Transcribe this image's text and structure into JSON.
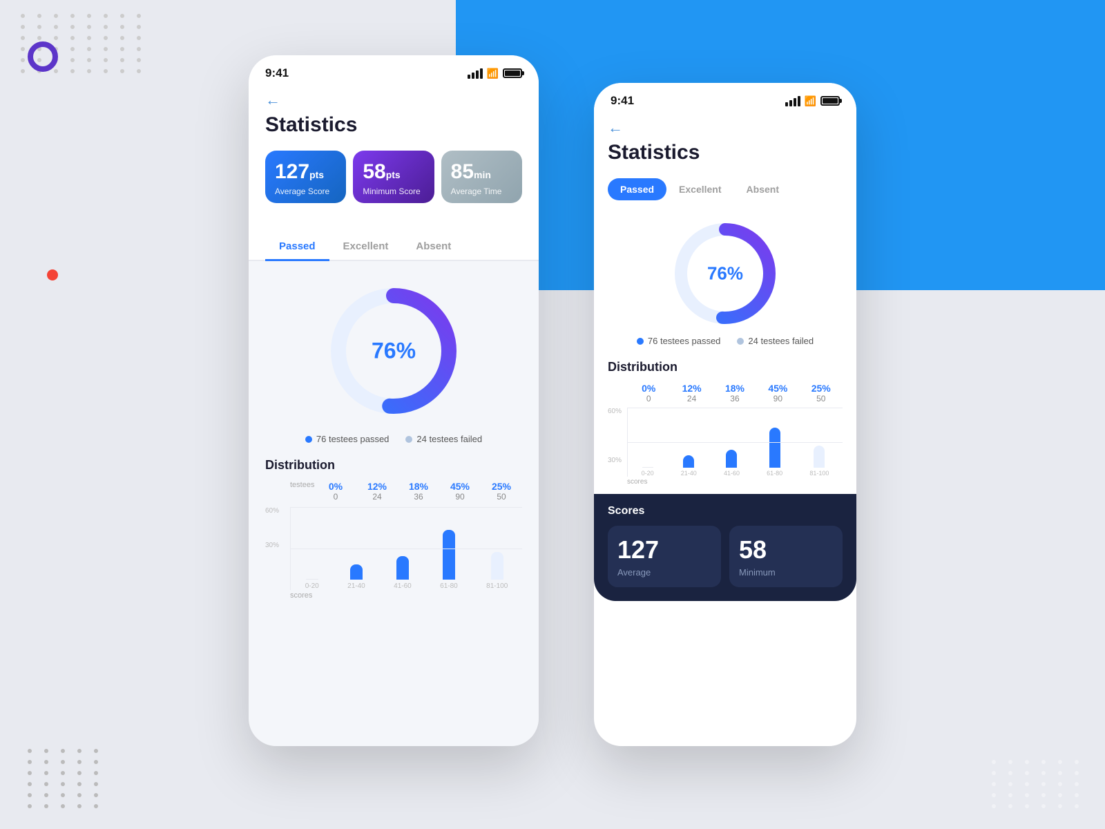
{
  "background": {
    "left_color": "#e8eaf0",
    "right_top_color": "#2196f3"
  },
  "left_phone": {
    "time": "9:41",
    "back_label": "←",
    "title": "Statistics",
    "score_cards": [
      {
        "value": "127",
        "unit": "pts",
        "label": "Average Score",
        "style": "blue"
      },
      {
        "value": "58",
        "unit": "pts",
        "label": "Minimum Score",
        "style": "purple"
      },
      {
        "value": "85",
        "unit": "min",
        "label": "Average Time",
        "style": "gray"
      }
    ],
    "tabs": [
      {
        "label": "Passed",
        "active": true
      },
      {
        "label": "Excellent",
        "active": false
      },
      {
        "label": "Absent",
        "active": false
      }
    ],
    "donut": {
      "percentage": "76%",
      "passed_pct": 76,
      "failed_pct": 24
    },
    "legend": [
      {
        "label": "76 testees passed",
        "color": "blue"
      },
      {
        "label": "24 testees failed",
        "color": "light"
      }
    ],
    "distribution": {
      "title": "Distribution",
      "columns": [
        {
          "pct": "0%",
          "count": "0",
          "range": "0-20"
        },
        {
          "pct": "12%",
          "count": "24",
          "range": "21-40"
        },
        {
          "pct": "18%",
          "count": "36",
          "range": "41-60"
        },
        {
          "pct": "45%",
          "count": "90",
          "range": "61-80"
        },
        {
          "pct": "25%",
          "count": "50",
          "range": "81-100"
        }
      ],
      "gridlines": [
        "60%",
        "30%"
      ],
      "x_label": "scores",
      "y_label": "testees"
    }
  },
  "right_phone": {
    "time": "9:41",
    "back_label": "←",
    "title": "Statistics",
    "tabs": [
      {
        "label": "Passed",
        "active": true
      },
      {
        "label": "Excellent",
        "active": false
      },
      {
        "label": "Absent",
        "active": false
      }
    ],
    "donut": {
      "percentage": "76%",
      "passed_pct": 76,
      "failed_pct": 24
    },
    "legend": [
      {
        "label": "76 testees passed",
        "color": "blue"
      },
      {
        "label": "24 testees failed",
        "color": "light"
      }
    ],
    "distribution": {
      "title": "Distribution",
      "columns": [
        {
          "pct": "0%",
          "count": "0",
          "range": "0-20"
        },
        {
          "pct": "12%",
          "count": "24",
          "range": "21-40"
        },
        {
          "pct": "18%",
          "count": "36",
          "range": "41-60"
        },
        {
          "pct": "45%",
          "count": "90",
          "range": "61-80"
        },
        {
          "pct": "25%",
          "count": "50",
          "range": "81-100"
        }
      ],
      "gridlines": [
        "60%",
        "30%"
      ]
    },
    "scores": {
      "title": "Scores",
      "cards": [
        {
          "value": "127",
          "label": "Average"
        },
        {
          "value": "58",
          "label": "Minimum"
        }
      ]
    }
  }
}
